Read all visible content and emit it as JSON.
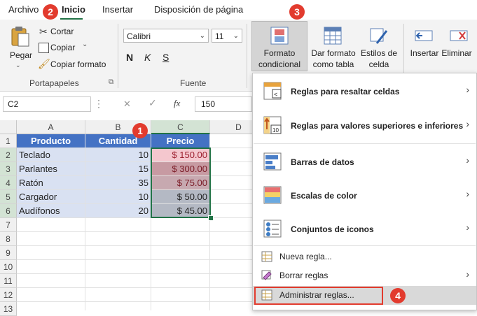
{
  "tabs": [
    {
      "label": "Archivo"
    },
    {
      "label": "Inicio"
    },
    {
      "label": "Insertar"
    },
    {
      "label": "Disposición de página"
    }
  ],
  "ribbon": {
    "clipboard": {
      "paste": "Pegar",
      "cut": "Cortar",
      "copy": "Copiar",
      "format_painter": "Copiar formato",
      "group_label": "Portapapeles"
    },
    "font": {
      "font_name": "Calibri",
      "font_size": "11",
      "bold": "N",
      "italic": "K",
      "underline": "S",
      "group_label": "Fuente"
    },
    "styles": {
      "conditional_line1": "Formato",
      "conditional_line2": "condicional",
      "table_line1": "Dar formato",
      "table_line2": "como tabla",
      "cell_styles_line1": "Estilos de",
      "cell_styles_line2": "celda"
    },
    "cells": {
      "insert": "Insertar",
      "delete": "Eliminar"
    }
  },
  "formula_bar": {
    "name_box": "C2",
    "fx": "fx",
    "value": "150"
  },
  "grid": {
    "columns": [
      "A",
      "B",
      "C",
      "D"
    ],
    "rows": [
      "1",
      "2",
      "3",
      "4",
      "5",
      "6",
      "7",
      "8",
      "9",
      "10",
      "11",
      "12",
      "13"
    ],
    "header_row": [
      "Producto",
      "Cantidad",
      "Precio"
    ],
    "data": [
      {
        "product": "Teclado",
        "qty": "10",
        "price": "$ 150.00"
      },
      {
        "product": "Parlantes",
        "qty": "15",
        "price": "$ 300.00"
      },
      {
        "product": "Ratón",
        "qty": "35",
        "price": "$ 75.00"
      },
      {
        "product": "Cargador",
        "qty": "10",
        "price": "$ 50.00"
      },
      {
        "product": "Audífonos",
        "qty": "20",
        "price": "$ 45.00"
      }
    ]
  },
  "menu": {
    "items": [
      {
        "label": "Reglas para resaltar celdas",
        "has_submenu": true
      },
      {
        "label": "Reglas para valores superiores e inferiores",
        "has_submenu": true
      },
      {
        "label": "Barras de datos",
        "has_submenu": true
      },
      {
        "label": "Escalas de color",
        "has_submenu": true
      },
      {
        "label": "Conjuntos de iconos",
        "has_submenu": true
      }
    ],
    "small_items": [
      {
        "label": "Nueva regla..."
      },
      {
        "label": "Borrar reglas"
      },
      {
        "label": "Administrar reglas..."
      }
    ]
  },
  "badges": [
    "1",
    "2",
    "3",
    "4"
  ],
  "colors": {
    "header_fill": "#4472c4",
    "row_fill": "#d9e1f2",
    "accent_green": "#217346",
    "badge_red": "#e23b2e",
    "highlight_border": "#e23b2e"
  }
}
